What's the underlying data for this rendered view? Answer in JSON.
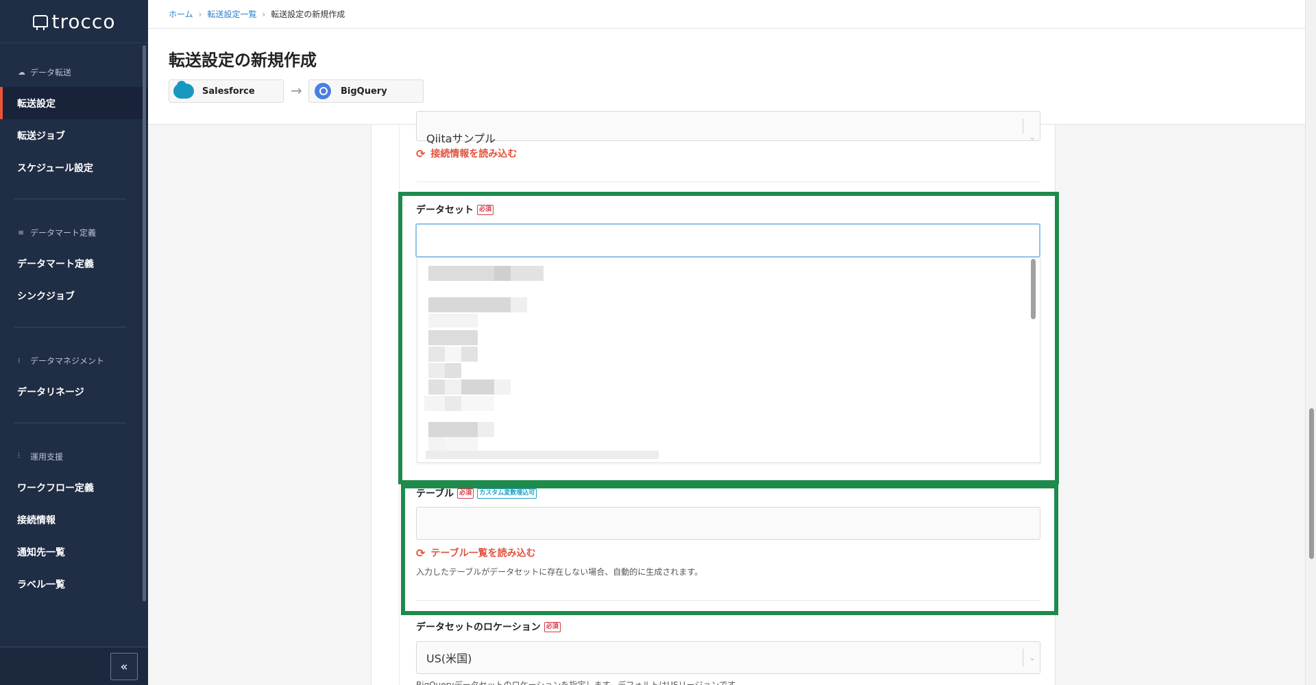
{
  "app": {
    "logo": "trocco"
  },
  "sidebar": {
    "sections": [
      {
        "heading": "データ転送",
        "items": [
          "転送設定",
          "転送ジョブ",
          "スケジュール設定"
        ]
      },
      {
        "heading": "データマート定義",
        "items": [
          "データマート定義",
          "シンクジョブ"
        ]
      },
      {
        "heading": "データマネジメント",
        "items": [
          "データリネージ"
        ]
      },
      {
        "heading": "運用支援",
        "items": [
          "ワークフロー定義",
          "接続情報",
          "通知先一覧",
          "ラベル一覧"
        ]
      }
    ],
    "active_item": "転送設定",
    "collapse_label": "«"
  },
  "breadcrumb": {
    "home": "ホーム",
    "list": "転送設定一覧",
    "current": "転送設定の新規作成"
  },
  "page": {
    "title": "転送設定の新規作成"
  },
  "connectors": {
    "source": "Salesforce",
    "destination": "BigQuery"
  },
  "form": {
    "connection_select_value": "Qiitaサンプル",
    "reload_connection": "接続情報を読み込む",
    "dataset": {
      "label": "データセット",
      "required": "必須",
      "value": ""
    },
    "table": {
      "label": "テーブル",
      "required": "必須",
      "custom_var": "カスタム変数埋込可",
      "value": "",
      "reload": "テーブル一覧を読み込む",
      "help": "入力したテーブルがデータセットに存在しない場合、自動的に生成されます。"
    },
    "location": {
      "label": "データセットのロケーション",
      "required": "必須",
      "value": "US(米国)",
      "help": "BigQueryデータセットのロケーションを指定します。デフォルトはUSリージョンです。"
    }
  },
  "colors": {
    "sidebar_bg": "#1f2d45",
    "accent": "#e0533d",
    "highlight": "#1e8a4c",
    "link": "#2a7fcf"
  },
  "icons": [
    "cloud-icon",
    "list-icon",
    "lineage-icon",
    "tune-icon",
    "reload-icon",
    "chevron-down-icon",
    "arrow-right-icon",
    "salesforce-logo",
    "bigquery-logo"
  ]
}
